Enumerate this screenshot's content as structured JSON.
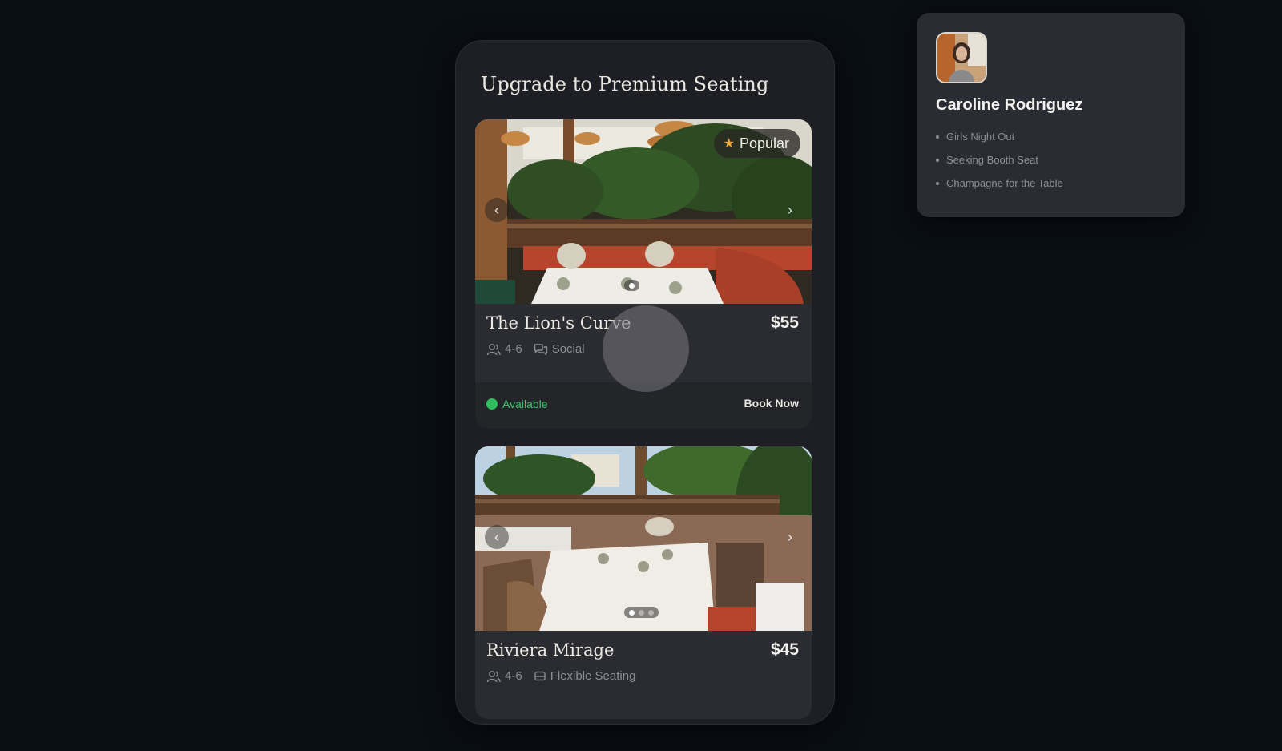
{
  "screen": {
    "title": "Upgrade to Premium Seating"
  },
  "seats": [
    {
      "name": "The Lion's Curve",
      "price": "$55",
      "badge": "Popular",
      "capacity": "4-6",
      "feature": "Social",
      "status": "Available",
      "action": "Book Now"
    },
    {
      "name": "Riviera Mirage",
      "price": "$45",
      "capacity": "4-6",
      "feature": "Flexible Seating"
    }
  ],
  "profile": {
    "name": "Caroline Rodriguez",
    "items": [
      "Girls Night Out",
      "Seeking Booth Seat",
      "Champagne for the Table"
    ]
  },
  "colors": {
    "background": "#0a0e15",
    "panel": "#1d1f24",
    "card": "#2a2c31",
    "available": "#2fbd5e",
    "star": "#f3a83b"
  },
  "icons": [
    "star-icon",
    "chevron-left-icon",
    "chevron-right-icon",
    "people-icon",
    "chat-icon",
    "seat-icon"
  ]
}
